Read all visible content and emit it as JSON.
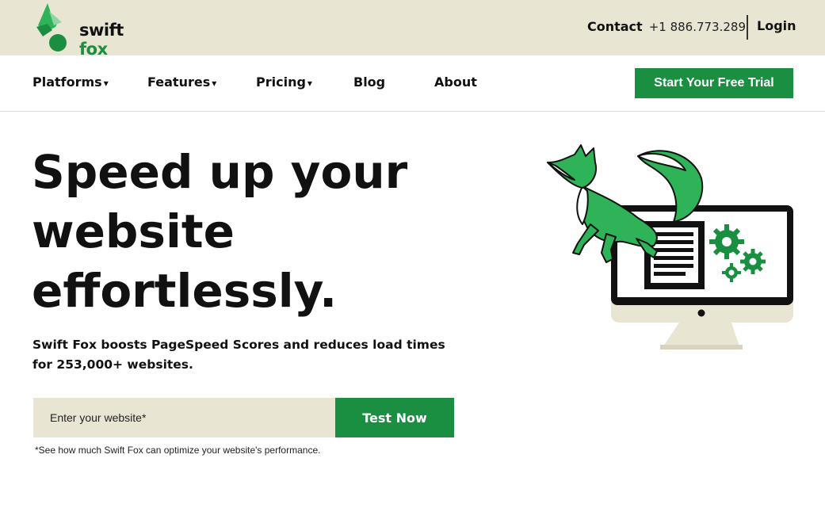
{
  "brand": {
    "name_part1": "swift",
    "name_part2": "fox",
    "accent_color": "#1b8f41",
    "cream_color": "#e9e5d3"
  },
  "topbar": {
    "contact_label": "Contact",
    "phone": "+1 886.773.289",
    "login_label": "Login"
  },
  "nav": {
    "items": [
      {
        "label": "Platforms",
        "dropdown": true
      },
      {
        "label": "Features",
        "dropdown": true
      },
      {
        "label": "Pricing",
        "dropdown": true
      },
      {
        "label": "Blog",
        "dropdown": false
      },
      {
        "label": "About",
        "dropdown": false
      }
    ],
    "caret": "▾",
    "cta_label": "Start Your Free Trial"
  },
  "hero": {
    "title_lines": [
      "Speed up your",
      "website",
      "effortlessly."
    ],
    "subtitle_lines": [
      "Swift Fox boosts PageSpeed Scores and reduces load times",
      "for 253,000+ websites."
    ],
    "input_placeholder": "Enter your website*",
    "test_button": "Test Now",
    "footnote": "*See how much Swift Fox can optimize your website's performance."
  },
  "illustration": {
    "icons": [
      "fox-icon",
      "monitor-icon",
      "document-icon",
      "gear-icon"
    ]
  }
}
